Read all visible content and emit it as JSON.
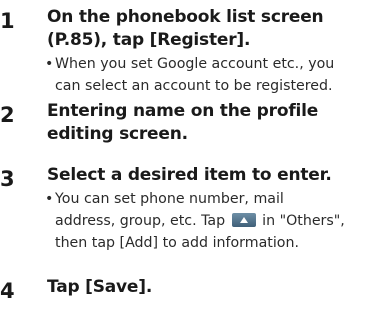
{
  "steps": [
    {
      "number": "1",
      "title_line1": "On the phonebook list screen",
      "title_line2": "(P.85), tap [Register].",
      "bullet": "•",
      "note_line1": "When you set Google account etc., you",
      "note_line2": "can select an account to be registered."
    },
    {
      "number": "2",
      "title_line1": "Entering name on the profile",
      "title_line2": "editing screen."
    },
    {
      "number": "3",
      "title_line1": "Select a desired item to enter.",
      "bullet": "•",
      "note_line1": "You can set phone number, mail",
      "note_line2": "address, group, etc. Tap",
      "note_line2b": "in \"Others\",",
      "note_line3": "then tap [Add] to add information.",
      "icon": "expand-up-icon"
    },
    {
      "number": "4",
      "title_line1": "Tap [Save]."
    }
  ]
}
